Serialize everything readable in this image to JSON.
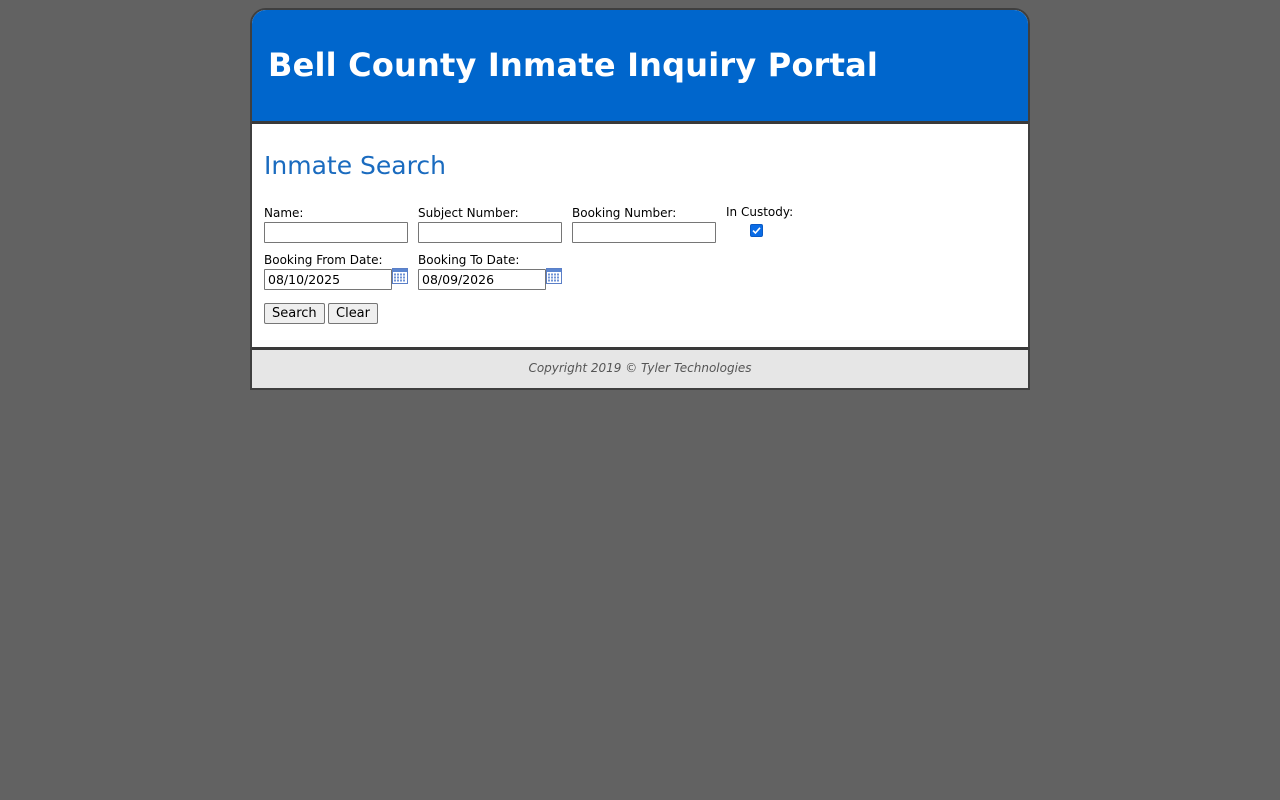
{
  "header": {
    "title": "Bell County Inmate Inquiry Portal"
  },
  "search_form": {
    "title": "Inmate Search",
    "name": {
      "label": "Name:",
      "value": ""
    },
    "subject_number": {
      "label": "Subject Number:",
      "value": ""
    },
    "booking_number": {
      "label": "Booking Number:",
      "value": ""
    },
    "in_custody": {
      "label": "In Custody:",
      "checked": true
    },
    "booking_from_date": {
      "label": "Booking From Date:",
      "value": "08/10/2025"
    },
    "booking_to_date": {
      "label": "Booking To Date:",
      "value": "08/09/2026"
    },
    "search_button": "Search",
    "clear_button": "Clear"
  },
  "footer": {
    "copyright": "Copyright 2019 © Tyler Technologies"
  },
  "colors": {
    "background": "#626262",
    "header": "#0066cc",
    "title_blue": "#1a6bbf",
    "footer_bg": "#e6e6e6"
  },
  "icons": {
    "calendar": "calendar-icon",
    "checkmark": "checkmark-icon"
  }
}
